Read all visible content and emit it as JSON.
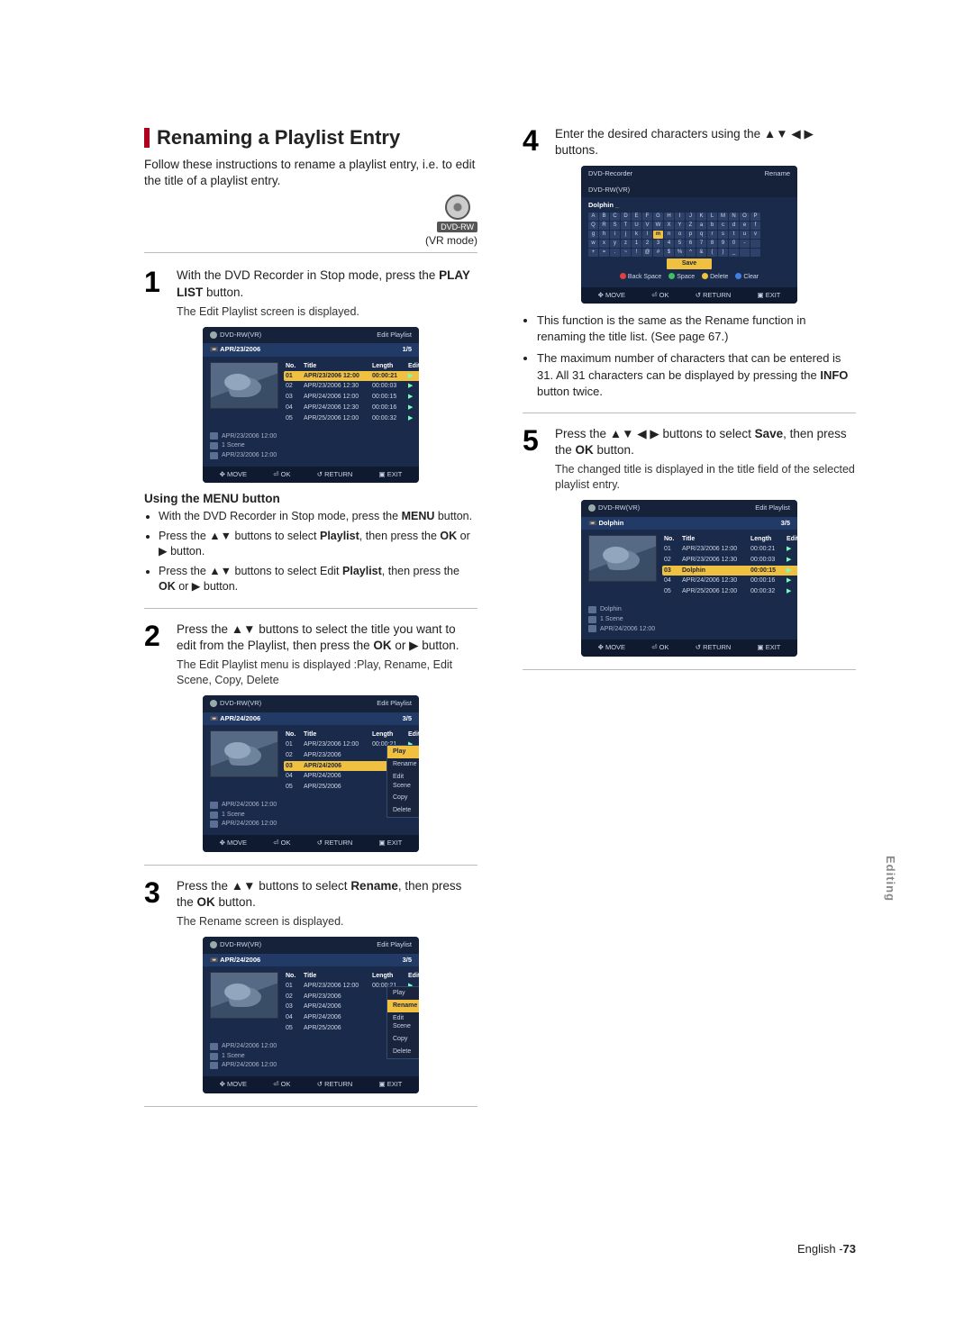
{
  "heading": "Renaming a Playlist Entry",
  "intro": "Follow these instructions to rename a playlist entry, i.e. to edit the title of a playlist entry.",
  "badge_label": "DVD-RW",
  "vr_mode": "(VR mode)",
  "steps": {
    "s1": {
      "num": "1",
      "text_a": "With the DVD Recorder in Stop mode, press the ",
      "bold": "PLAY LIST",
      "text_b": " button.",
      "sub": "The Edit Playlist screen is displayed."
    },
    "menu_head": "Using the MENU button",
    "menu_items": [
      "With the DVD Recorder in Stop mode, press the MENU button.",
      "Press the ▲▼ buttons to select Playlist, then press the OK or ▶ button.",
      "Press the ▲▼ buttons to select Edit Playlist, then press the OK or ▶ button."
    ],
    "s2": {
      "num": "2",
      "text_a": "Press the ▲▼ buttons to select the title you want to edit from the Playlist, then press the ",
      "bold": "OK",
      "text_b": " or ▶ button.",
      "sub": "The Edit Playlist menu is displayed :Play, Rename, Edit Scene, Copy, Delete"
    },
    "s3": {
      "num": "3",
      "text_a": "Press the ▲▼ buttons to select ",
      "bold": "Rename",
      "text_b": ", then press the ",
      "bold2": "OK",
      "text_c": " button.",
      "sub": "The Rename screen is displayed."
    },
    "s4": {
      "num": "4",
      "text": "Enter the desired characters using the ▲▼ ◀ ▶ buttons."
    },
    "s5": {
      "num": "5",
      "text_a": "Press the ▲▼ ◀ ▶ buttons to select ",
      "bold": "Save",
      "text_b": ", then press the ",
      "bold2": "OK",
      "text_c": " button.",
      "sub": "The changed title is displayed in the title field of the selected playlist entry."
    }
  },
  "osd_common": {
    "device": "DVD-RW(VR)",
    "edit_pl": "Edit Playlist",
    "cols": {
      "no": "No.",
      "title": "Title",
      "length": "Length",
      "edit": "Edit"
    },
    "footer": {
      "move": "MOVE",
      "ok": "OK",
      "return": "RETURN",
      "exit": "EXIT"
    },
    "meta_scene": "1 Scene"
  },
  "osd1": {
    "subtitle": "APR/23/2006",
    "counter": "1/5",
    "rows": [
      {
        "no": "01",
        "title": "APR/23/2006 12:00",
        "len": "00:00:21",
        "sel": true
      },
      {
        "no": "02",
        "title": "APR/23/2006 12:30",
        "len": "00:00:03"
      },
      {
        "no": "03",
        "title": "APR/24/2006 12:00",
        "len": "00:00:15"
      },
      {
        "no": "04",
        "title": "APR/24/2006 12:30",
        "len": "00:00:16"
      },
      {
        "no": "05",
        "title": "APR/25/2006 12:00",
        "len": "00:00:32"
      }
    ],
    "meta_date": "APR/23/2006 12:00",
    "meta_date2": "APR/23/2006 12:00"
  },
  "osd2": {
    "subtitle": "APR/24/2006",
    "counter": "3/5",
    "rows": [
      {
        "no": "01",
        "title": "APR/23/2006 12:00",
        "len": "00:00:21"
      },
      {
        "no": "02",
        "title": "APR/23/2006"
      },
      {
        "no": "03",
        "title": "APR/24/2006",
        "sel": true
      },
      {
        "no": "04",
        "title": "APR/24/2006"
      },
      {
        "no": "05",
        "title": "APR/25/2006"
      }
    ],
    "menu": [
      "Play",
      "Rename",
      "Edit Scene",
      "Copy",
      "Delete"
    ],
    "menu_sel": 0,
    "meta_date": "APR/24/2006 12:00",
    "meta_date2": "APR/24/2006 12:00"
  },
  "osd3": {
    "subtitle": "APR/24/2006",
    "counter": "3/5",
    "rows": [
      {
        "no": "01",
        "title": "APR/23/2006 12:00",
        "len": "00:00:21"
      },
      {
        "no": "02",
        "title": "APR/23/2006"
      },
      {
        "no": "03",
        "title": "APR/24/2006"
      },
      {
        "no": "04",
        "title": "APR/24/2006"
      },
      {
        "no": "05",
        "title": "APR/25/2006"
      }
    ],
    "menu": [
      "Play",
      "Rename",
      "Edit Scene",
      "Copy",
      "Delete"
    ],
    "menu_sel": 1,
    "meta_date": "APR/24/2006 12:00",
    "meta_date2": "APR/24/2006 12:00"
  },
  "osd4": {
    "title_left": "DVD-Recorder",
    "title_right": "Rename",
    "field": "Dolphin",
    "rows": [
      [
        "A",
        "B",
        "C",
        "D",
        "E",
        "F",
        "G",
        "H",
        "I",
        "J",
        "K",
        "L",
        "M",
        "N",
        "O",
        "P"
      ],
      [
        "Q",
        "R",
        "S",
        "T",
        "U",
        "V",
        "W",
        "X",
        "Y",
        "Z",
        "a",
        "b",
        "c",
        "d",
        "e",
        "f"
      ],
      [
        "g",
        "h",
        "i",
        "j",
        "k",
        "l",
        "m",
        "n",
        "o",
        "p",
        "q",
        "r",
        "s",
        "t",
        "u",
        "v"
      ],
      [
        "w",
        "x",
        "y",
        "z",
        "1",
        "2",
        "3",
        "4",
        "5",
        "6",
        "7",
        "8",
        "9",
        "0",
        "-",
        " "
      ],
      [
        "+",
        "=",
        ".",
        "~",
        "!",
        "@",
        "#",
        "$",
        "%",
        "^",
        "&",
        "(",
        ")",
        "_",
        " ",
        " "
      ]
    ],
    "sel_row": 2,
    "sel_col": 6,
    "save": "Save",
    "actions": {
      "back": "Back Space",
      "space": "Space",
      "delete": "Delete",
      "clear": "Clear"
    }
  },
  "right_bullets": [
    "This function is the same as the Rename function in renaming the title list. (See page 67.)",
    "The maximum number of characters that can be entered is 31. All 31 characters can be displayed by pressing the INFO button twice."
  ],
  "osd5": {
    "subtitle": "Dolphin",
    "counter": "3/5",
    "rows": [
      {
        "no": "01",
        "title": "APR/23/2006 12:00",
        "len": "00:00:21"
      },
      {
        "no": "02",
        "title": "APR/23/2006 12:30",
        "len": "00:00:03"
      },
      {
        "no": "03",
        "title": "Dolphin",
        "len": "00:00:15",
        "sel": true
      },
      {
        "no": "04",
        "title": "APR/24/2006 12:30",
        "len": "00:00:16"
      },
      {
        "no": "05",
        "title": "APR/25/2006 12:00",
        "len": "00:00:32"
      }
    ],
    "meta_date": "Dolphin",
    "meta_date2": "APR/24/2006 12:00"
  },
  "side_tab": "Editing",
  "footer": {
    "lang": "English -",
    "page": "73"
  }
}
